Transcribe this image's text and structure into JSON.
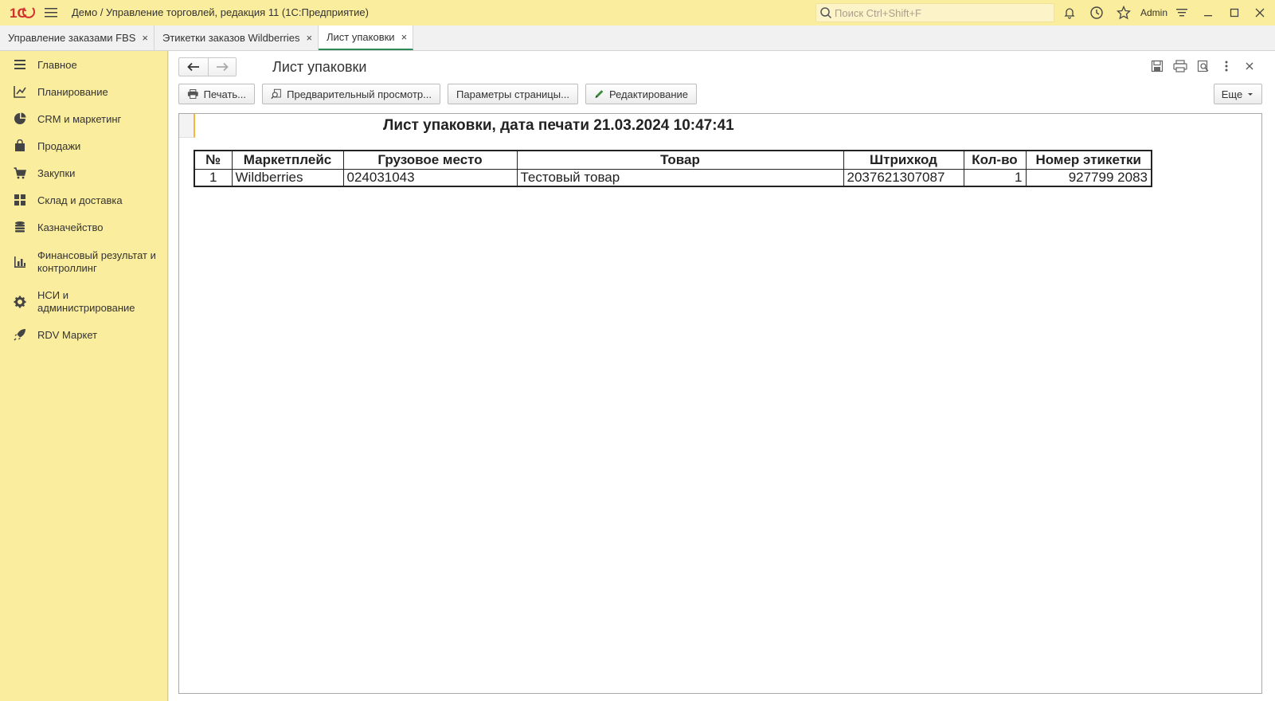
{
  "titlebar": {
    "app_title": "Демо / Управление торговлей, редакция 11  (1С:Предприятие)",
    "search_placeholder": "Поиск Ctrl+Shift+F",
    "user": "Admin"
  },
  "tabs": [
    {
      "label": "Управление заказами FBS",
      "close": "×"
    },
    {
      "label": "Этикетки заказов Wildberries",
      "close": "×"
    },
    {
      "label": "Лист упаковки",
      "close": "×"
    }
  ],
  "sidebar": {
    "items": [
      {
        "label": "Главное",
        "icon": "menu-lines-icon"
      },
      {
        "label": "Планирование",
        "icon": "planning-chart-icon"
      },
      {
        "label": "CRM и маркетинг",
        "icon": "pie-chart-icon"
      },
      {
        "label": "Продажи",
        "icon": "shopping-bag-icon"
      },
      {
        "label": "Закупки",
        "icon": "shopping-cart-icon"
      },
      {
        "label": "Склад и доставка",
        "icon": "warehouse-grid-icon"
      },
      {
        "label": "Казначейство",
        "icon": "coins-stack-icon"
      },
      {
        "label": "Финансовый результат и контроллинг",
        "icon": "bar-chart-icon"
      },
      {
        "label": "НСИ и администрирование",
        "icon": "gear-icon"
      },
      {
        "label": "RDV Маркет",
        "icon": "rocket-icon"
      }
    ]
  },
  "main": {
    "title": "Лист упаковки",
    "buttons": {
      "print": "Печать...",
      "preview": "Предварительный просмотр...",
      "page_params": "Параметры страницы...",
      "edit": "Редактирование",
      "more": "Еще"
    }
  },
  "report": {
    "title": "Лист упаковки, дата печати 21.03.2024 10:47:41",
    "columns": [
      "№",
      "Маркетплейс",
      "Грузовое место",
      "Товар",
      "Штрихкод",
      "Кол-во",
      "Номер этикетки"
    ],
    "rows": [
      [
        "1",
        "Wildberries",
        "024031043",
        "Тестовый товар",
        "2037621307087",
        "1",
        "927799 2083"
      ]
    ]
  },
  "colors": {
    "sidebar_bg": "#fbed9e",
    "active_tab_accent": "#2e8b57",
    "logo_red": "#d0312d"
  }
}
